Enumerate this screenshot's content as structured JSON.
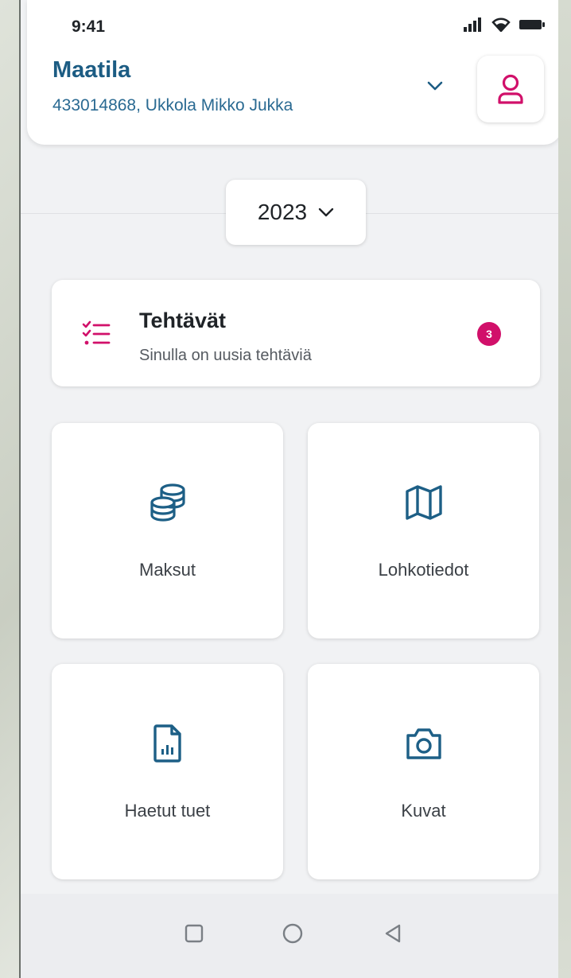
{
  "status_bar": {
    "time": "9:41",
    "icons": [
      "signal-icon",
      "wifi-icon",
      "battery-icon"
    ]
  },
  "farm": {
    "title": "Maatila",
    "subtitle": "433014868, Ukkola Mikko Jukka"
  },
  "year_selector": {
    "value": "2023"
  },
  "tasks": {
    "title": "Tehtävät",
    "subtitle": "Sinulla on uusia tehtäviä",
    "badge_count": "3"
  },
  "tiles": [
    {
      "label": "Maksut",
      "icon": "coins-icon"
    },
    {
      "label": "Lohkotiedot",
      "icon": "map-icon"
    },
    {
      "label": "Haetut tuet",
      "icon": "document-chart-icon"
    },
    {
      "label": "Kuvat",
      "icon": "camera-icon"
    }
  ],
  "colors": {
    "brand_blue": "#1c5c83",
    "accent_pink": "#d1106a",
    "icon_blue": "#1d5f86",
    "background": "#f1f2f4"
  }
}
